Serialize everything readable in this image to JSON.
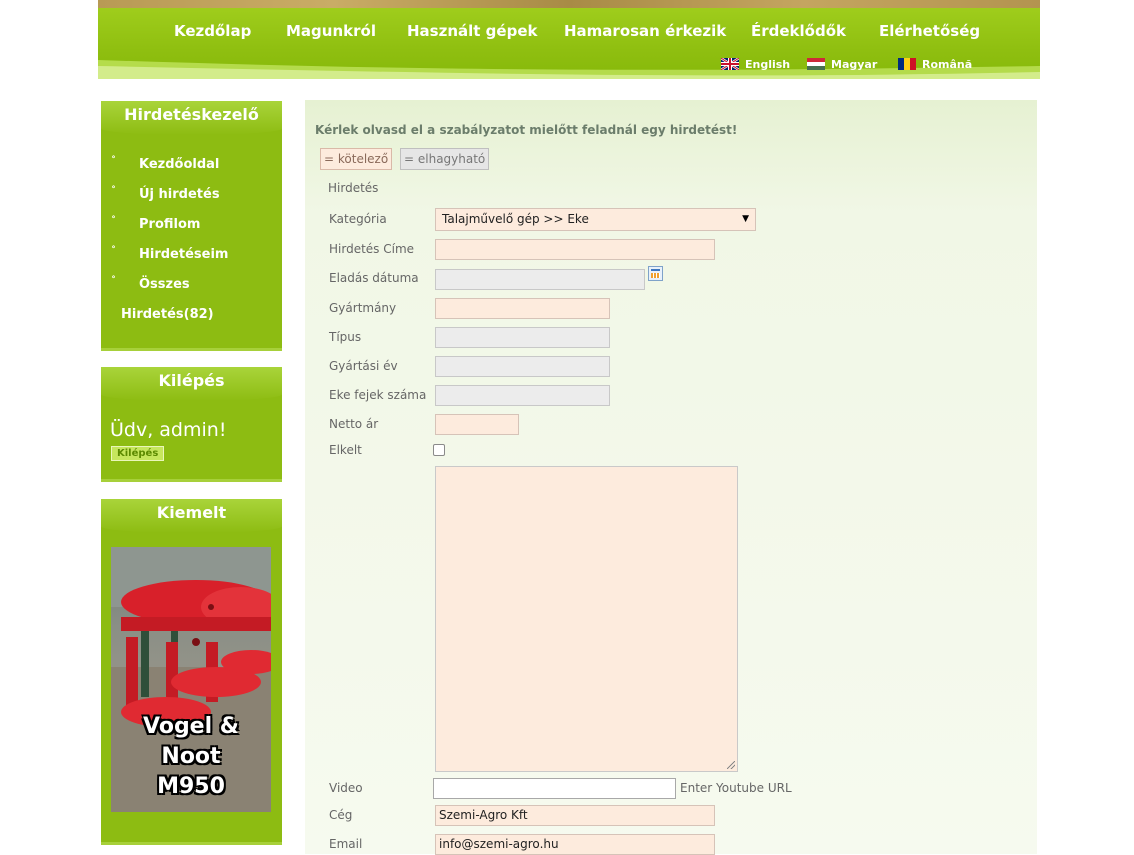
{
  "nav": {
    "items": [
      {
        "label": "Kezdőlap"
      },
      {
        "label": "Magunkról"
      },
      {
        "label": "Használt gépek"
      },
      {
        "label": "Hamarosan érkezik"
      },
      {
        "label": "Érdeklődők"
      },
      {
        "label": "Elérhetőség"
      }
    ],
    "languages": [
      {
        "label": "English",
        "flag": "uk-flag-icon"
      },
      {
        "label": "Magyar",
        "flag": "hungary-flag-icon"
      },
      {
        "label": "Română",
        "flag": "romania-flag-icon"
      }
    ]
  },
  "sidebar": {
    "manager": {
      "title": "Hirdetéskezelő",
      "items": [
        {
          "label": "Kezdőoldal"
        },
        {
          "label": "Új hirdetés"
        },
        {
          "label": "Profilom"
        },
        {
          "label": "Hirdetéseim"
        },
        {
          "label": "Összes"
        }
      ],
      "count_label": "Hirdetés(82)"
    },
    "logout_box": {
      "title": "Kilépés",
      "welcome": "Üdv, admin!",
      "button": "Kilépés"
    },
    "featured": {
      "title": "Kiemelt",
      "caption_line1": "Vogel & Noot",
      "caption_line2": "M950"
    }
  },
  "form": {
    "notice": "Kérlek olvasd el a szabályzatot mielőtt feladnál egy hirdetést!",
    "legend_required": "= kötelező",
    "legend_optional": "= elhagyható",
    "section_title": "Hirdetés",
    "category": {
      "label": "Kategória",
      "value": "Talajművelő gép >> Eke"
    },
    "title": {
      "label": "Hirdetés Címe",
      "value": ""
    },
    "sale_date": {
      "label": "Eladás dátuma",
      "value": ""
    },
    "manufacturer": {
      "label": "Gyártmány",
      "value": ""
    },
    "type": {
      "label": "Típus",
      "value": ""
    },
    "year": {
      "label": "Gyártási év",
      "value": ""
    },
    "heads": {
      "label": "Eke fejek száma",
      "value": ""
    },
    "price": {
      "label": "Netto ár",
      "value": ""
    },
    "sold": {
      "label": "Elkelt",
      "checked": false
    },
    "video": {
      "label": "Video",
      "value": "",
      "hint": "Enter Youtube URL"
    },
    "company": {
      "label": "Cég",
      "value": "Szemi-Agro Kft"
    },
    "email": {
      "label": "Email",
      "value": "info@szemi-agro.hu"
    }
  },
  "colors": {
    "brand_green": "#8dbc12",
    "required_bg": "#fdebdd",
    "optional_bg": "#ececec"
  }
}
